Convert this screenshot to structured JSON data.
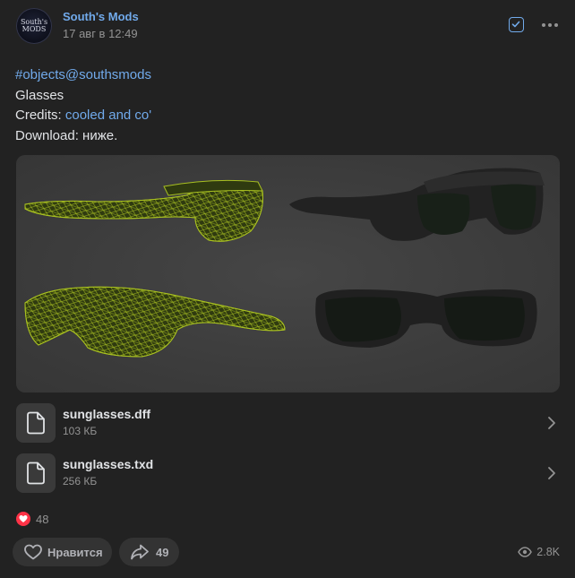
{
  "post": {
    "author": "South's Mods",
    "avatar_text": "South's Mods",
    "date": "17 авг в 12:49",
    "text": {
      "hashtag": "#objects@southsmods",
      "line2": "Glasses",
      "credits_prefix": "Credits: ",
      "credits_link": "cooled and co'",
      "line4": "Download: ниже."
    },
    "image": {
      "alt": "3D model of sunglasses: wireframe and shaded views"
    },
    "attachments": [
      {
        "name": "sunglasses.dff",
        "size": "103 КБ",
        "icon": "document-icon"
      },
      {
        "name": "sunglasses.txd",
        "size": "256 КБ",
        "icon": "document-icon"
      }
    ],
    "reactions": {
      "icon": "heart-icon",
      "count": "48"
    },
    "actions": {
      "like_label": "Нравится",
      "share_count": "49"
    },
    "views": "2.8K"
  },
  "colors": {
    "background": "#222222",
    "link": "#71aaeb",
    "like_red": "#ff3347",
    "secondary_text": "#939393"
  }
}
